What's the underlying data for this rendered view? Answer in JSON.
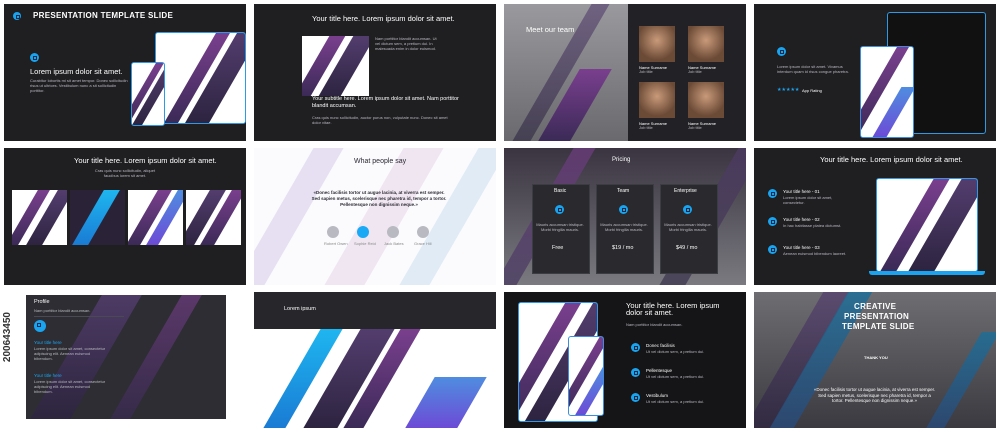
{
  "slides": {
    "s1": {
      "title": "PRESENTATION TEMPLATE SLIDE",
      "heading": "Lorem ipsum dolor sit amet.",
      "body": "Curabitur lobortis mi sit amet tempor. Donec sollicitudin risus ut ultrices. Vestibulum nunc a sit sollicitudin porttitor."
    },
    "s2": {
      "title": "Your title here. Lorem ipsum dolor sit amet.",
      "body": "Nam porttitor blandit accumsan. Ut vel dictum sem, a pretium dui. In malesuada enim in dolor euismod.",
      "subtitle": "Your subtitle here. Lorem ipsum dolor sit amet. Nam porttitor blandit accumsan.",
      "body2": "Cras quis nunc sollicitudin, auctor purus non, vulputate nunc. Donec sit amet dolor vitae."
    },
    "s3": {
      "title": "Meet our team",
      "members": [
        {
          "name": "Name Surname",
          "role": "Job title"
        },
        {
          "name": "Name Surname",
          "role": "Job title"
        },
        {
          "name": "Name Surname",
          "role": "Job title"
        },
        {
          "name": "Name Surname",
          "role": "Job title"
        }
      ]
    },
    "s4": {
      "body": "Lorem ipsum dolor sit amet. Vivamus interdum quam id risus congue pharetra.",
      "rating_label": "App Rating",
      "stars": "★★★★★"
    },
    "s5": {
      "title": "Your title here. Lorem ipsum dolor sit amet.",
      "body": "Cras quis nunc sollicitudin, aliquet faucibus lorem sit amet."
    },
    "s6": {
      "title": "What people say",
      "quote": "«Donec facilisis tortor ut augue lacinia, at viverra est semper. Sed sapien metus, scelerisque nec pharetra id, tempor a tortor. Pellentesque non dignissim neque.»",
      "people": [
        {
          "label": "AVA",
          "name": "Robert Owen"
        },
        {
          "label": "AVA",
          "name": "Sophie Reid"
        },
        {
          "label": "AVA",
          "name": "Jack Bates"
        },
        {
          "label": "AVA",
          "name": "Grace Hill"
        }
      ]
    },
    "s7": {
      "title": "Pricing",
      "plans": [
        {
          "name": "Basic",
          "price": "Free"
        },
        {
          "name": "Team",
          "price": "$19 / mo"
        },
        {
          "name": "Enterprise",
          "price": "$49 / mo"
        }
      ],
      "plan_body": "Mauris accumsan tristique. Morbi fringilla mauris."
    },
    "s8": {
      "title": "Your title here. Lorem ipsum dolor sit amet.",
      "items": [
        {
          "title": "Your title here - 01",
          "body": "Lorem ipsum dolor sit amet, consectetur."
        },
        {
          "title": "Your title here - 02",
          "body": "In hac habitasse platea dictumst."
        },
        {
          "title": "Your title here - 03",
          "body": "Aenean euismod bibendum laoreet."
        }
      ]
    },
    "s9": {
      "title": "Profile",
      "subtitle": "Nam porttitor blandit accumsan.",
      "label1": "Your title here",
      "label2": "Your title here",
      "body": "Lorem ipsum dolor sit amet, consectetur adipiscing elit. Aenean euismod bibendum."
    },
    "s10": {
      "title": "Lorem ipsum"
    },
    "s11": {
      "title": "Your title here. Lorem ipsum dolor sit amet.",
      "body": "Nam porttitor blandit accumsan.",
      "items": [
        "Donec facilisis",
        "Pellentesque",
        "Vestibulum"
      ],
      "item_body": "Ut vel dictum sem, a pretium dui."
    },
    "s12": {
      "title_line1": "CREATIVE",
      "title_line2": "PRESENTATION",
      "title_line3": "TEMPLATE SLIDE",
      "caption": "THANK YOU",
      "quote": "«Donec facilisis tortor ut augue lacinia, at viverra est semper. Sed sapien metus, scelerisque nec pharetra id, tempor a tortor. Pellentesque non dignissim neque.»"
    }
  },
  "watermark": "Adobe Stock",
  "stock_id": "200643450",
  "colors": {
    "accent": "#1aa3ef",
    "purple": "#5b3a7a",
    "dark": "#1f1f22"
  }
}
